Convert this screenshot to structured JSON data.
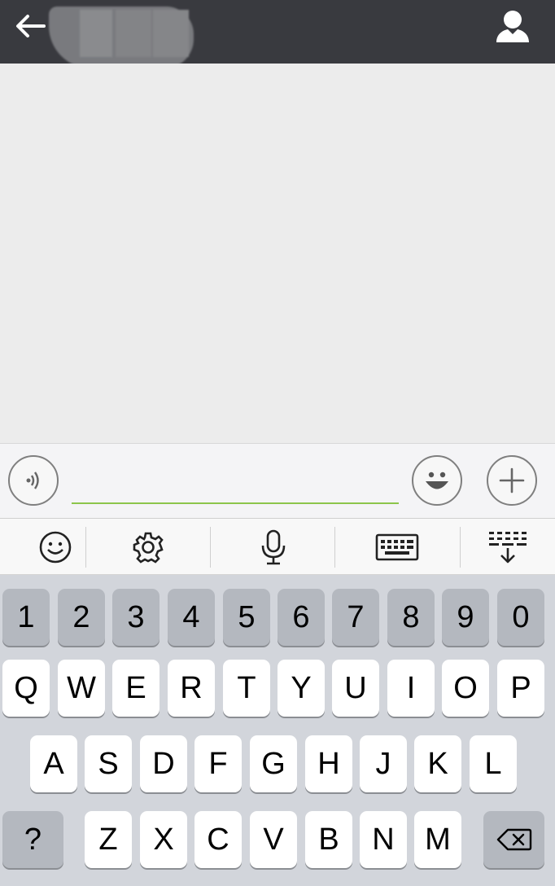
{
  "header": {
    "back_icon": "arrow-left-icon",
    "profile_icon": "person-icon",
    "title_obscured": true
  },
  "input_bar": {
    "voice_icon": "voice-wave-icon",
    "text_value": "",
    "emoji_icon": "smiley-icon",
    "plus_icon": "plus-icon",
    "accent_color": "#8cc54a"
  },
  "toolbar": {
    "items": [
      "smiley-icon",
      "gear-icon",
      "microphone-icon",
      "keyboard-icon",
      "keyboard-hide-icon"
    ]
  },
  "keyboard": {
    "row1": [
      "1",
      "2",
      "3",
      "4",
      "5",
      "6",
      "7",
      "8",
      "9",
      "0"
    ],
    "row2": [
      "Q",
      "W",
      "E",
      "R",
      "T",
      "Y",
      "U",
      "I",
      "O",
      "P"
    ],
    "row3": [
      "A",
      "S",
      "D",
      "F",
      "G",
      "H",
      "J",
      "K",
      "L"
    ],
    "row4": [
      "?",
      "Z",
      "X",
      "C",
      "V",
      "B",
      "N",
      "M"
    ],
    "delete_icon": "backspace-icon"
  },
  "colors": {
    "header_bg": "#393a3f",
    "chat_bg": "#ececec",
    "keyboard_bg": "#d2d5db"
  }
}
